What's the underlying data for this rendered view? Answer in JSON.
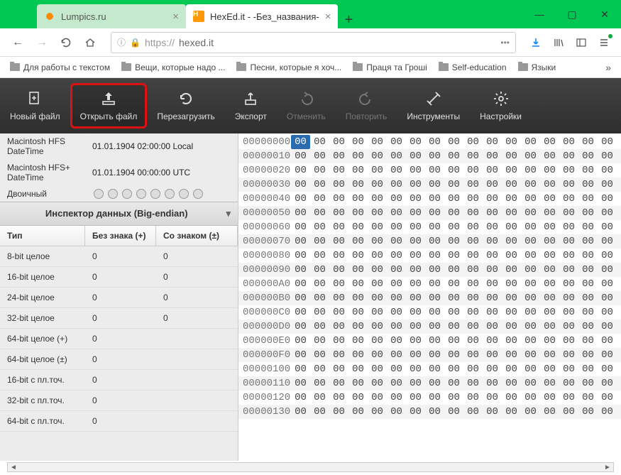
{
  "window": {
    "tabs": [
      {
        "title": "Lumpics.ru",
        "active": false
      },
      {
        "title": "HexEd.it - -Без_названия-",
        "active": true
      }
    ],
    "newtab": "+",
    "controls": {
      "min": "—",
      "max": "▢",
      "close": "✕"
    }
  },
  "nav": {
    "url_proto": "https://",
    "url_host": "hexed.it",
    "info_icon": "ⓘ",
    "lock_icon": "🔒"
  },
  "bookmarks": [
    "Для работы с текстом",
    "Вещи, которые надо ...",
    "Песни, которые я хоч...",
    "Праця та Гроші",
    "Self-education",
    "Языки"
  ],
  "toolbar": [
    {
      "label": "Новый файл",
      "icon": "new",
      "disabled": false
    },
    {
      "label": "Открыть файл",
      "icon": "open",
      "disabled": false,
      "highlighted": true
    },
    {
      "label": "Перезагрузить",
      "icon": "reload",
      "disabled": false
    },
    {
      "label": "Экспорт",
      "icon": "export",
      "disabled": false
    },
    {
      "label": "Отменить",
      "icon": "undo",
      "disabled": true
    },
    {
      "label": "Повторить",
      "icon": "redo",
      "disabled": true
    },
    {
      "label": "Инструменты",
      "icon": "tools",
      "disabled": false
    },
    {
      "label": "Настройки",
      "icon": "settings",
      "disabled": false
    }
  ],
  "datetimes": [
    {
      "k": "Macintosh HFS DateTime",
      "v": "01.01.1904 02:00:00 Local"
    },
    {
      "k": "Macintosh HFS+ DateTime",
      "v": "01.01.1904 00:00:00 UTC"
    },
    {
      "k": "Двоичный",
      "v": ""
    }
  ],
  "inspector_title": "Инспектор данных (Big-endian)",
  "inspector_headers": {
    "type": "Тип",
    "unsigned": "Без знака (+)",
    "signed": "Со знаком (±)"
  },
  "inspector_rows": [
    {
      "type": "8-bit целое",
      "unsigned": "0",
      "signed": "0"
    },
    {
      "type": "16-bit целое",
      "unsigned": "0",
      "signed": "0"
    },
    {
      "type": "24-bit целое",
      "unsigned": "0",
      "signed": "0"
    },
    {
      "type": "32-bit целое",
      "unsigned": "0",
      "signed": "0"
    },
    {
      "type": "64-bit целое (+)",
      "unsigned": "0",
      "signed": ""
    },
    {
      "type": "64-bit целое (±)",
      "unsigned": "0",
      "signed": ""
    },
    {
      "type": "16-bit с пл.точ.",
      "unsigned": "0",
      "signed": ""
    },
    {
      "type": "32-bit с пл.точ.",
      "unsigned": "0",
      "signed": ""
    },
    {
      "type": "64-bit с пл.точ.",
      "unsigned": "0",
      "signed": ""
    }
  ],
  "hex": {
    "offsets": [
      "00000000",
      "00000010",
      "00000020",
      "00000030",
      "00000040",
      "00000050",
      "00000060",
      "00000070",
      "00000080",
      "00000090",
      "000000A0",
      "000000B0",
      "000000C0",
      "000000D0",
      "000000E0",
      "000000F0",
      "00000100",
      "00000110",
      "00000120",
      "00000130"
    ],
    "byte": "00",
    "cols": 17,
    "selected_row": 0,
    "selected_col": 0
  }
}
